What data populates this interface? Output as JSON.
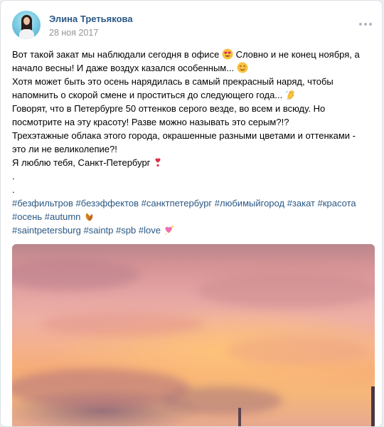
{
  "post": {
    "author": "Элина Третьякова",
    "date": "28 ноя 2017",
    "text_lines": [
      "Вот такой закат мы наблюдали сегодня в офисе",
      "Словно и не конец ноября, а",
      "начало весны! И даже воздух казался особенным...",
      "Хотя может быть это осень нарядилась в самый прекрасный наряд, чтобы",
      "напомнить о скорой смене и проститься до следующего года...",
      "Говорят, что в Петербурге 50 оттенков серого везде, во всем и всюду. Но",
      "посмотрите на эту красоту! Разве можно называть это серым?!?",
      "Трехэтажные облака этого города, окрашенные разными цветами и оттенками -",
      "это ли не великолепие?!",
      "Я люблю тебя, Санкт-Петербург",
      ".",
      "."
    ],
    "hashtags_line1": [
      "#безфильтров",
      "#безэффектов",
      "#санктпетербург",
      "#любимыйгород",
      "#закат",
      "#красота"
    ],
    "hashtags_line2": [
      "#осень",
      "#autumn"
    ],
    "hashtags_line3": [
      "#saintpetersburg",
      "#saintp",
      "#spb",
      "#love"
    ],
    "emojis": [
      "heart-eyes-emoji",
      "blush-emoji",
      "waving-hand-emoji",
      "heart-exclamation-emoji",
      "fallen-leaf-emoji",
      "sparkling-heart-emoji"
    ]
  },
  "colors": {
    "link": "#2a5885",
    "secondary_text": "#939393",
    "page_background": "#edeef0"
  }
}
